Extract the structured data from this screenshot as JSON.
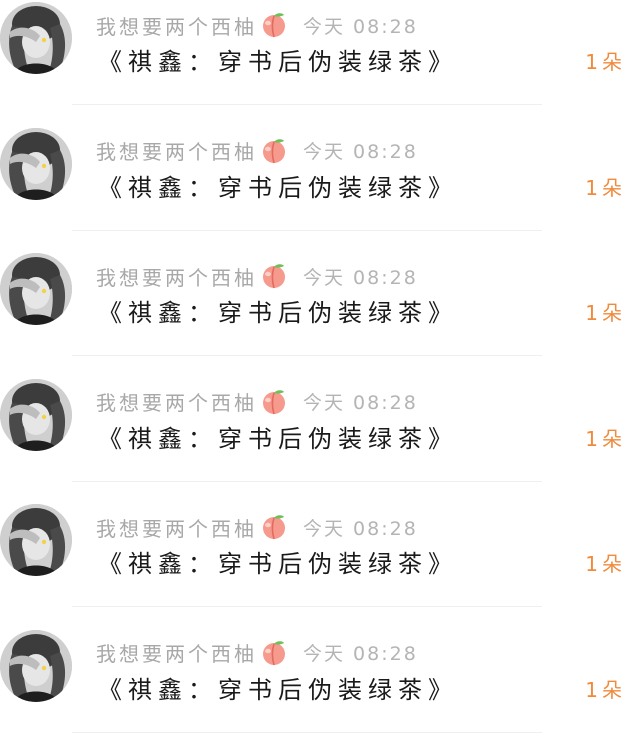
{
  "colors": {
    "background": "#ffffff",
    "username": "#a8a8a8",
    "timestamp": "#b4b4b4",
    "title": "#1a1a1a",
    "count_accent": "#f08a3c",
    "divider": "#efefef"
  },
  "entries": [
    {
      "avatar_icon": "avatar-photo",
      "username": "我想要两个西柚",
      "username_emoji_icon": "peach-icon",
      "timestamp": "今天 08:28",
      "title": "《祺鑫：穿书后伪装绿茶》",
      "count": "1朵"
    },
    {
      "avatar_icon": "avatar-photo",
      "username": "我想要两个西柚",
      "username_emoji_icon": "peach-icon",
      "timestamp": "今天 08:28",
      "title": "《祺鑫：穿书后伪装绿茶》",
      "count": "1朵"
    },
    {
      "avatar_icon": "avatar-photo",
      "username": "我想要两个西柚",
      "username_emoji_icon": "peach-icon",
      "timestamp": "今天 08:28",
      "title": "《祺鑫：穿书后伪装绿茶》",
      "count": "1朵"
    },
    {
      "avatar_icon": "avatar-photo",
      "username": "我想要两个西柚",
      "username_emoji_icon": "peach-icon",
      "timestamp": "今天 08:28",
      "title": "《祺鑫：穿书后伪装绿茶》",
      "count": "1朵"
    },
    {
      "avatar_icon": "avatar-photo",
      "username": "我想要两个西柚",
      "username_emoji_icon": "peach-icon",
      "timestamp": "今天 08:28",
      "title": "《祺鑫：穿书后伪装绿茶》",
      "count": "1朵"
    },
    {
      "avatar_icon": "avatar-photo",
      "username": "我想要两个西柚",
      "username_emoji_icon": "peach-icon",
      "timestamp": "今天 08:28",
      "title": "《祺鑫：穿书后伪装绿茶》",
      "count": "1朵"
    }
  ]
}
